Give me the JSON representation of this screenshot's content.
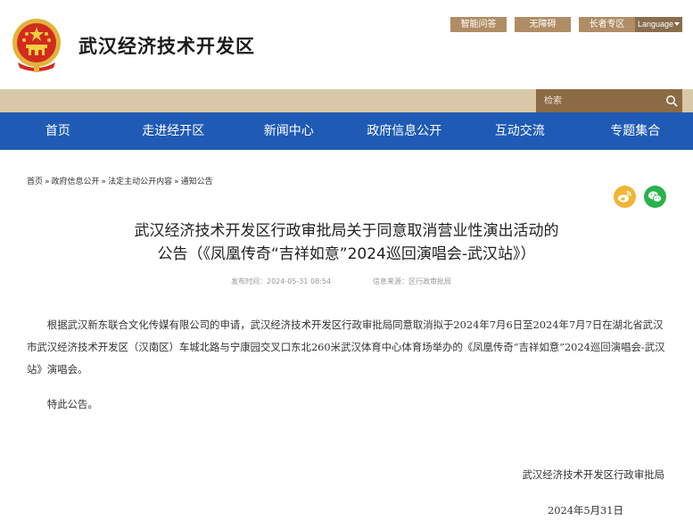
{
  "header": {
    "site_title": "武汉经济技术开发区",
    "top_links": [
      "智能问答",
      "无障碍",
      "长者专区"
    ],
    "language_label": "Language",
    "emblem_icon": "national-emblem-icon"
  },
  "search": {
    "placeholder": "检索"
  },
  "nav": {
    "items": [
      "首页",
      "走进经开区",
      "新闻中心",
      "政府信息公开",
      "互动交流",
      "专题集合"
    ]
  },
  "breadcrumb": {
    "items": [
      "首页",
      "政府信息公开",
      "法定主动公开内容",
      "通知公告"
    ],
    "separator": "»"
  },
  "share": {
    "weibo_icon": "weibo-icon",
    "wechat_icon": "wechat-icon"
  },
  "article": {
    "title_line1": "武汉经济技术开发区行政审批局关于同意取消营业性演出活动的",
    "title_line2": "公告（《凤凰传奇“吉祥如意”2024巡回演唱会-武汉站》）",
    "publish_label": "发布时间：2024-05-31 08:54",
    "source_label": "信息来源：区行政审批局",
    "paragraph1": "根据武汉新东联合文化传媒有限公司的申请，武汉经济技术开发区行政审批局同意取消拟于2024年7月6日至2024年7月7日在湖北省武汉市武汉经济技术开发区（汉南区）车城北路与宁康园交叉口东北260米武汉体育中心体育场举办的《凤凰传奇“吉祥如意”2024巡回演唱会-武汉站》演唱会。",
    "paragraph2": "特此公告。",
    "signature": "武汉经济技术开发区行政审批局",
    "date": "2024年5月31日"
  },
  "colors": {
    "nav_blue": "#1f5bb5",
    "gold": "#b08d65",
    "dark_gold": "#8a6d4c",
    "band": "#d8c8a8"
  }
}
